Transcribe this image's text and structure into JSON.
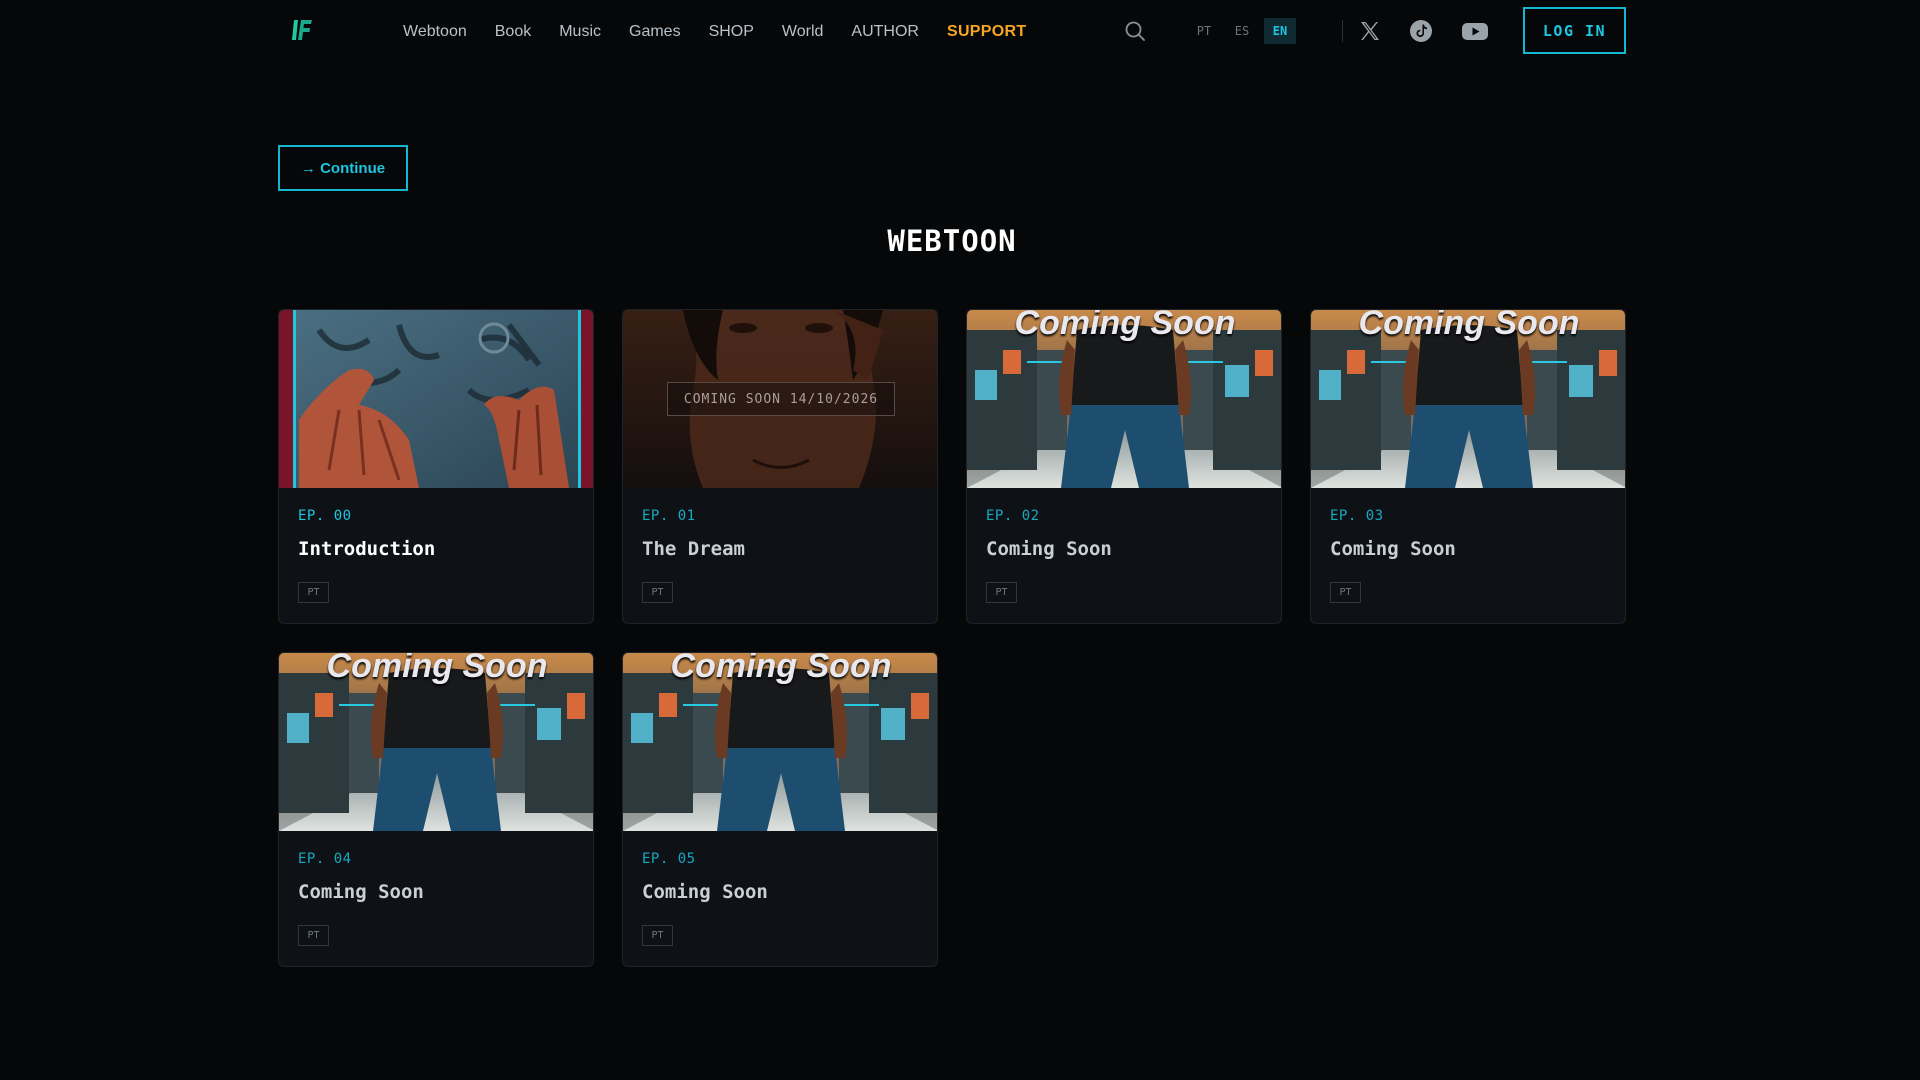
{
  "nav": {
    "links": [
      {
        "label": "Webtoon"
      },
      {
        "label": "Book"
      },
      {
        "label": "Music"
      },
      {
        "label": "Games"
      },
      {
        "label": "SHOP"
      },
      {
        "label": "World"
      },
      {
        "label": "AUTHOR"
      },
      {
        "label": "SUPPORT"
      }
    ],
    "languages": [
      "PT",
      "ES",
      "EN"
    ],
    "active_language": "EN",
    "login_label": "LOG IN",
    "icons": [
      "logo-icon",
      "search-icon",
      "x-icon",
      "tiktok-icon",
      "youtube-icon"
    ]
  },
  "continue_label": "→ Continue",
  "section_title": "WEBTOON",
  "episodes": [
    {
      "ep": "EP. 00",
      "title": "Introduction",
      "tag": "PT",
      "thumb": "hands"
    },
    {
      "ep": "EP. 01",
      "title": "The Dream",
      "tag": "PT",
      "thumb": "dream",
      "badge": "COMING SOON 14/10/2026"
    },
    {
      "ep": "EP. 02",
      "title": "Coming Soon",
      "tag": "PT",
      "thumb": "coming-soon",
      "thumb_text": "Coming Soon"
    },
    {
      "ep": "EP. 03",
      "title": "Coming Soon",
      "tag": "PT",
      "thumb": "coming-soon",
      "thumb_text": "Coming Soon"
    },
    {
      "ep": "EP. 04",
      "title": "Coming Soon",
      "tag": "PT",
      "thumb": "coming-soon",
      "thumb_text": "Coming Soon"
    },
    {
      "ep": "EP. 05",
      "title": "Coming Soon",
      "tag": "PT",
      "thumb": "coming-soon",
      "thumb_text": "Coming Soon"
    }
  ],
  "colors": {
    "background": "#050709",
    "accent": "#1ec6df",
    "support": "#f5a623",
    "card": "#0e1216"
  }
}
